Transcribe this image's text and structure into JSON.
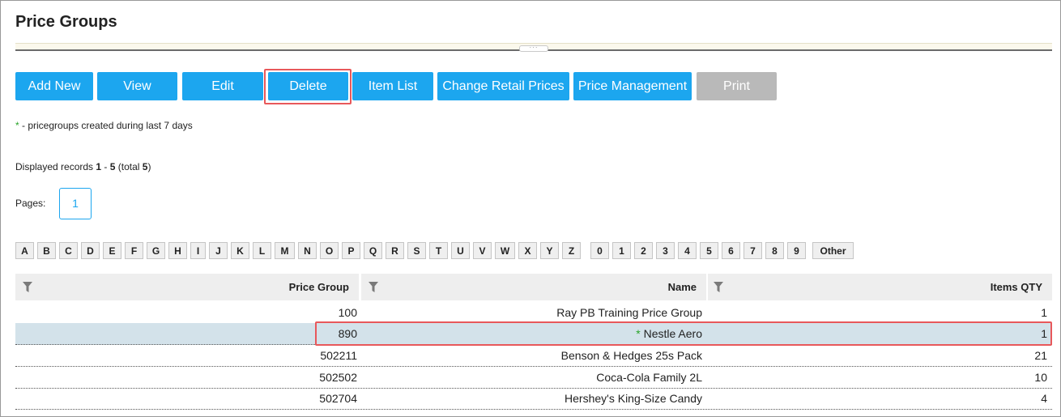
{
  "page": {
    "title": "Price Groups"
  },
  "toolbar": {
    "buttons": [
      {
        "label": "Add New"
      },
      {
        "label": "View"
      },
      {
        "label": "Edit"
      },
      {
        "label": "Delete"
      },
      {
        "label": "Item List"
      },
      {
        "label": "Change Retail Prices"
      },
      {
        "label": "Price Management"
      },
      {
        "label": "Print"
      }
    ]
  },
  "legend": {
    "marker": "*",
    "text": " - pricegroups created during last 7 days"
  },
  "records": {
    "prefix": "Displayed records ",
    "from": "1",
    "sep": " - ",
    "to": "5",
    "total_prefix": " (total ",
    "total": "5",
    "total_suffix": ")"
  },
  "pager": {
    "label": "Pages:",
    "current": "1"
  },
  "alphabet": [
    "A",
    "B",
    "C",
    "D",
    "E",
    "F",
    "G",
    "H",
    "I",
    "J",
    "K",
    "L",
    "M",
    "N",
    "O",
    "P",
    "Q",
    "R",
    "S",
    "T",
    "U",
    "V",
    "W",
    "X",
    "Y",
    "Z",
    "0",
    "1",
    "2",
    "3",
    "4",
    "5",
    "6",
    "7",
    "8",
    "9",
    "Other"
  ],
  "table": {
    "columns": [
      "Price Group",
      "Name",
      "Items QTY"
    ],
    "rows": [
      {
        "group": "100",
        "marker": "",
        "name": "Ray PB Training Price Group",
        "qty": "1"
      },
      {
        "group": "890",
        "marker": "* ",
        "name": "Nestle Aero",
        "qty": "1"
      },
      {
        "group": "502211",
        "marker": "",
        "name": "Benson & Hedges 25s Pack",
        "qty": "21"
      },
      {
        "group": "502502",
        "marker": "",
        "name": "Coca-Cola Family 2L",
        "qty": "10"
      },
      {
        "group": "502704",
        "marker": "",
        "name": "Hershey's King-Size Candy",
        "qty": "4"
      }
    ]
  },
  "colors": {
    "accent": "#1ca6ef",
    "disabled": "#b9b9b9",
    "highlight": "#e8585b",
    "selected_row": "#d3e2ea",
    "new_marker": "#2aa52a"
  },
  "icons": {
    "filter": "filter-icon",
    "grip": "splitter-grip-icon"
  }
}
